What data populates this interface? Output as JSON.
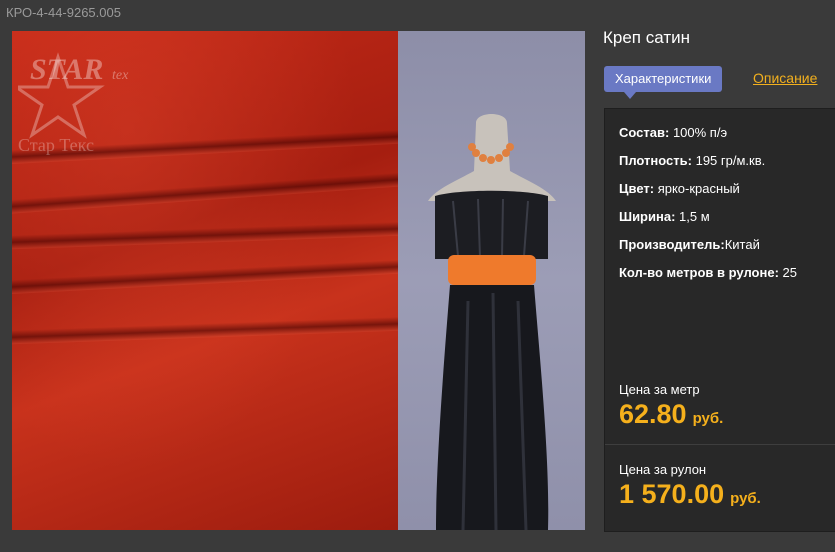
{
  "product": {
    "sku": "КРО-4-44-9265.005",
    "title": "Креп сатин",
    "watermark": {
      "logo_text": "STAR",
      "logo_sub": "tex",
      "caption": "Стар Текс"
    }
  },
  "tabs": {
    "characteristics": "Характеристики",
    "description": "Описание"
  },
  "specs": [
    {
      "label": "Состав:",
      "value": "100% п/э"
    },
    {
      "label": "Плотность:",
      "value": "195 гр/м.кв."
    },
    {
      "label": "Цвет:",
      "value": "ярко-красный"
    },
    {
      "label": "Ширина:",
      "value": "1,5 м"
    },
    {
      "label": "Производитель:",
      "value": "Китай"
    },
    {
      "label": "Кол-во метров в рулоне:",
      "value": "25"
    }
  ],
  "pricing": {
    "per_meter_label": "Цена за метр",
    "per_meter_value": "62.80",
    "per_roll_label": "Цена за рулон",
    "per_roll_value": "1 570.00",
    "currency": "руб."
  },
  "colors": {
    "accent": "#f5b01c",
    "tab_active": "#6a79c4",
    "fabric": "#c42a18"
  }
}
